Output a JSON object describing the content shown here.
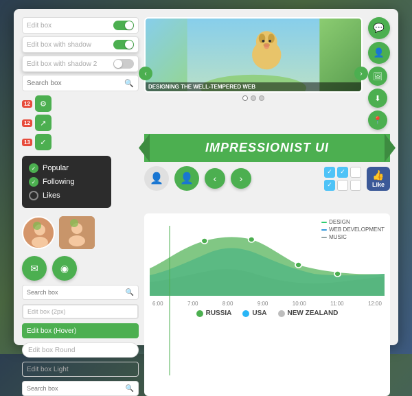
{
  "app": {
    "title": "Impressionist UI"
  },
  "inputs": {
    "edit_box": "Edit box",
    "edit_box_shadow": "Edit box with shadow",
    "edit_box_shadow2": "Edit box with shadow 2",
    "search_box": "Search box",
    "search_box2": "Search box",
    "edit_box_2px": "Edit box (2px)",
    "edit_box_hover": "Edit box (Hover)",
    "edit_box_round": "Edit box Round",
    "edit_box_light": "Edit box Light",
    "search_box3": "Search box"
  },
  "toggles": {
    "t1": "on",
    "t2": "on",
    "t3": "off"
  },
  "badges": {
    "b1": "12",
    "b2": "12",
    "b3": "13"
  },
  "dropdown": {
    "items": [
      {
        "label": "Popular",
        "state": "checked"
      },
      {
        "label": "Following",
        "state": "checked"
      },
      {
        "label": "Likes",
        "state": "empty"
      }
    ]
  },
  "banner": {
    "text": "IMPRESSIONIST UI"
  },
  "carousel": {
    "caption": "DESIGNING THE WELL-TEMPERED WEB"
  },
  "chart": {
    "legend": [
      {
        "label": "DESIGN",
        "color": "#2ecc71"
      },
      {
        "label": "WEB DEVELOPMENT",
        "color": "#3498db"
      },
      {
        "label": "MUSIC",
        "color": "#95a5a6"
      }
    ],
    "x_labels": [
      "6:00",
      "7:00",
      "8:00",
      "9:00",
      "10:00",
      "11:00",
      "12:00"
    ],
    "countries": [
      {
        "label": "RUSSIA",
        "color": "#4caf50"
      },
      {
        "label": "USA",
        "color": "#29b6f6"
      },
      {
        "label": "NEW ZEALAND",
        "color": "#bdbdbd"
      }
    ]
  },
  "icons": {
    "chat": "💬",
    "user_add": "👤",
    "download": "⬇",
    "map": "📍",
    "photo": "🖼",
    "email": "✉",
    "rss": "◉",
    "share": "↗",
    "check": "✓",
    "chevron_left": "‹",
    "chevron_right": "›",
    "search": "🔍",
    "person": "👤",
    "like": "👍",
    "gear": "⚙"
  }
}
